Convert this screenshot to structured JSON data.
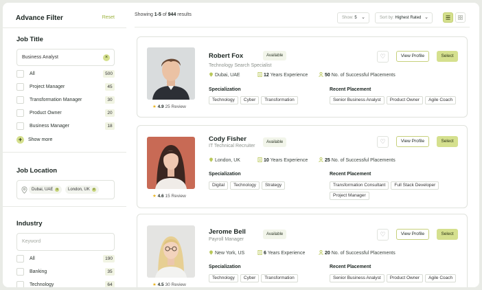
{
  "sidebar": {
    "title": "Advance Filter",
    "reset": "Reset",
    "job_title": {
      "heading": "Job Title",
      "search_value": "Business Analyst",
      "options": [
        {
          "label": "All",
          "count": "500"
        },
        {
          "label": "Project Manager",
          "count": "45"
        },
        {
          "label": "Transformation Manager",
          "count": "30"
        },
        {
          "label": "Product Owner",
          "count": "20"
        },
        {
          "label": "Business Manager",
          "count": "18"
        }
      ],
      "show_more": "Show more"
    },
    "job_location": {
      "heading": "Job Location",
      "chips": [
        "Dubai, UAE",
        "London, UK"
      ]
    },
    "industry": {
      "heading": "Industry",
      "placeholder": "Keyword",
      "options": [
        {
          "label": "All",
          "count": "190"
        },
        {
          "label": "Banking",
          "count": "35"
        },
        {
          "label": "Technology",
          "count": "64"
        }
      ]
    }
  },
  "toolbar": {
    "results_prefix": "Showing ",
    "results_range": "1-5",
    "results_of": " of ",
    "results_total": "944",
    "results_suffix": " results",
    "show_label": "Show: ",
    "show_value": "5",
    "sort_label": "Sort by: ",
    "sort_value": "Highest Rated"
  },
  "card_labels": {
    "specialization": "Specialization",
    "recent_placement": "Recent Placement",
    "view_profile": "View Profile",
    "select": "Select",
    "experience_suffix": "Years Experience",
    "placements_suffix": "No. of Successful Placements",
    "review_suffix": "Review"
  },
  "candidates": [
    {
      "name": "Robert Fox",
      "status": "Available",
      "role": "Technology Search Specialist",
      "location": "Dubai, UAE",
      "years": "12",
      "placements": "50",
      "rating": "4.9",
      "reviews": "25",
      "specialization": [
        "Technology",
        "Cyber",
        "Transformation"
      ],
      "recent": [
        "Senior Business Analyst",
        "Product Owner",
        "Agile Coach"
      ]
    },
    {
      "name": "Cody Fisher",
      "status": "Available",
      "role": "IT Technical Recruiter",
      "location": "London, UK",
      "years": "10",
      "placements": "25",
      "rating": "4.6",
      "reviews": "15",
      "specialization": [
        "Digital",
        "Technology",
        "Strategy"
      ],
      "recent": [
        "Transformation Consultant",
        "Full Stack Developer",
        "Project Manager"
      ]
    },
    {
      "name": "Jerome Bell",
      "status": "Available",
      "role": "Payroll Manager",
      "location": "New York, US",
      "years": "6",
      "placements": "20",
      "rating": "4.5",
      "reviews": "30",
      "specialization": [
        "Technology",
        "Cyber",
        "Transformation"
      ],
      "recent": [
        "Senior Business Analyst",
        "Product Owner",
        "Agile Coach"
      ]
    }
  ],
  "colors": {
    "accent": "#d5e08e",
    "accent_text": "#9bb13c",
    "star": "#e8b422"
  }
}
